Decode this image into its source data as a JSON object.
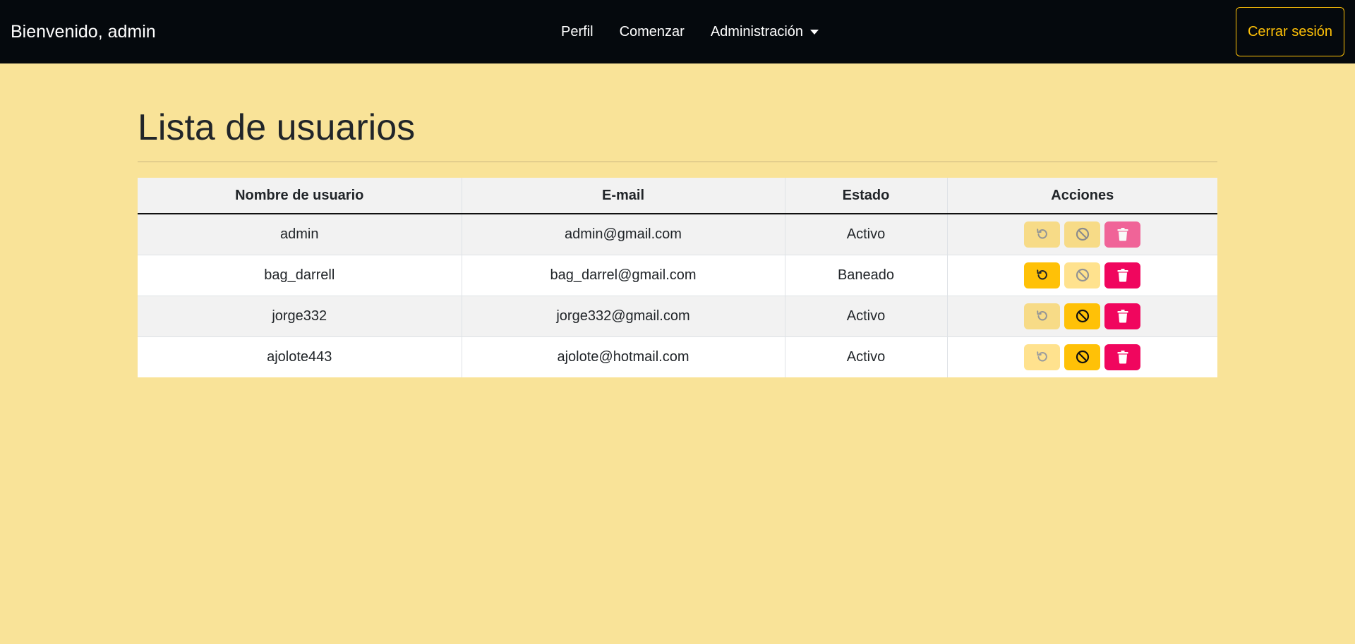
{
  "navbar": {
    "brand": "Bienvenido, admin",
    "links": [
      "Perfil",
      "Comenzar",
      "Administración"
    ],
    "logout_label": "Cerrar sesión"
  },
  "page": {
    "title": "Lista de usuarios"
  },
  "table": {
    "headers": [
      "Nombre de usuario",
      "E-mail",
      "Estado",
      "Acciones"
    ],
    "rows": [
      {
        "username": "admin",
        "email": "admin@gmail.com",
        "status": "Activo",
        "restore_enabled": false,
        "ban_enabled": false,
        "delete_enabled": false
      },
      {
        "username": "bag_darrell",
        "email": "bag_darrel@gmail.com",
        "status": "Baneado",
        "restore_enabled": true,
        "ban_enabled": false,
        "delete_enabled": true
      },
      {
        "username": "jorge332",
        "email": "jorge332@gmail.com",
        "status": "Activo",
        "restore_enabled": false,
        "ban_enabled": true,
        "delete_enabled": true
      },
      {
        "username": "ajolote443",
        "email": "ajolote@hotmail.com",
        "status": "Activo",
        "restore_enabled": false,
        "ban_enabled": true,
        "delete_enabled": true
      }
    ],
    "action_icons": [
      "restore-icon",
      "ban-icon",
      "trash-icon"
    ]
  },
  "colors": {
    "navbar_bg": "#05090d",
    "page_bg": "#f9e398",
    "warning": "#ffc107",
    "danger": "#f0065e"
  }
}
